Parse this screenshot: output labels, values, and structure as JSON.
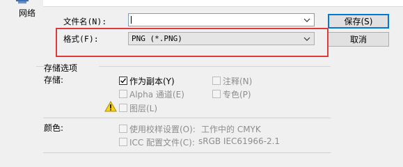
{
  "nav": {
    "network_label": "网络"
  },
  "filename": {
    "label": "文件名(N):",
    "value": ""
  },
  "format": {
    "label": "格式(F):",
    "value": "PNG (*.PNG)"
  },
  "buttons": {
    "save": "保存(S)",
    "cancel": "取消"
  },
  "storage": {
    "group_title": "存储选项",
    "section_label": "存储:",
    "options": [
      {
        "label": "作为副本(Y)",
        "checked": true,
        "enabled": true
      },
      {
        "label": "注释(N)",
        "checked": false,
        "enabled": false
      },
      {
        "label": "Alpha 通道(E)",
        "checked": false,
        "enabled": false
      },
      {
        "label": "专色(P)",
        "checked": false,
        "enabled": false
      },
      {
        "label": "图层(L)",
        "checked": false,
        "enabled": false
      }
    ]
  },
  "color": {
    "section_label": "颜色:",
    "options": [
      {
        "label": "使用校样设置(O):",
        "extra": "工作中的 CMYK",
        "checked": false,
        "enabled": false
      },
      {
        "label": "ICC 配置文件(C):",
        "extra": "sRGB IEC61966-2.1",
        "checked": false,
        "enabled": false
      }
    ]
  },
  "colors": {
    "highlight_box": "#e0393c",
    "default_button_border": "#0078d7"
  },
  "icons": {
    "network": "network-icon",
    "warning": "warning-icon",
    "dropdown": "chevron-down-icon"
  }
}
